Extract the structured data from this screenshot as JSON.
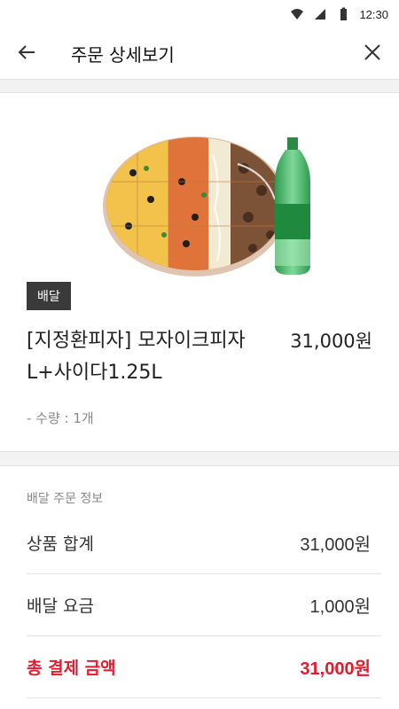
{
  "status_bar": {
    "time": "12:30",
    "icons": [
      "wifi-icon",
      "signal-icon",
      "battery-icon"
    ]
  },
  "header": {
    "title": "주문 상세보기",
    "back_icon": "arrow-left-icon",
    "close_icon": "close-icon"
  },
  "product": {
    "image": "pizza-and-soda-image",
    "badge": "배달",
    "name": "[지정환피자] 모자이크피자L+사이다1.25L",
    "price": "31,000원",
    "quantity": "- 수량 : 1개"
  },
  "order_info": {
    "section_title": "배달 주문 정보",
    "rows": [
      {
        "label": "상품 합계",
        "value": "31,000원"
      },
      {
        "label": "배달 요금",
        "value": "1,000원"
      }
    ],
    "total": {
      "label": "총 결제 금액",
      "value": "31,000원"
    }
  },
  "colors": {
    "accent": "#e8192c",
    "badge_bg": "#3a3a3a",
    "background": "#f2f2f2"
  }
}
